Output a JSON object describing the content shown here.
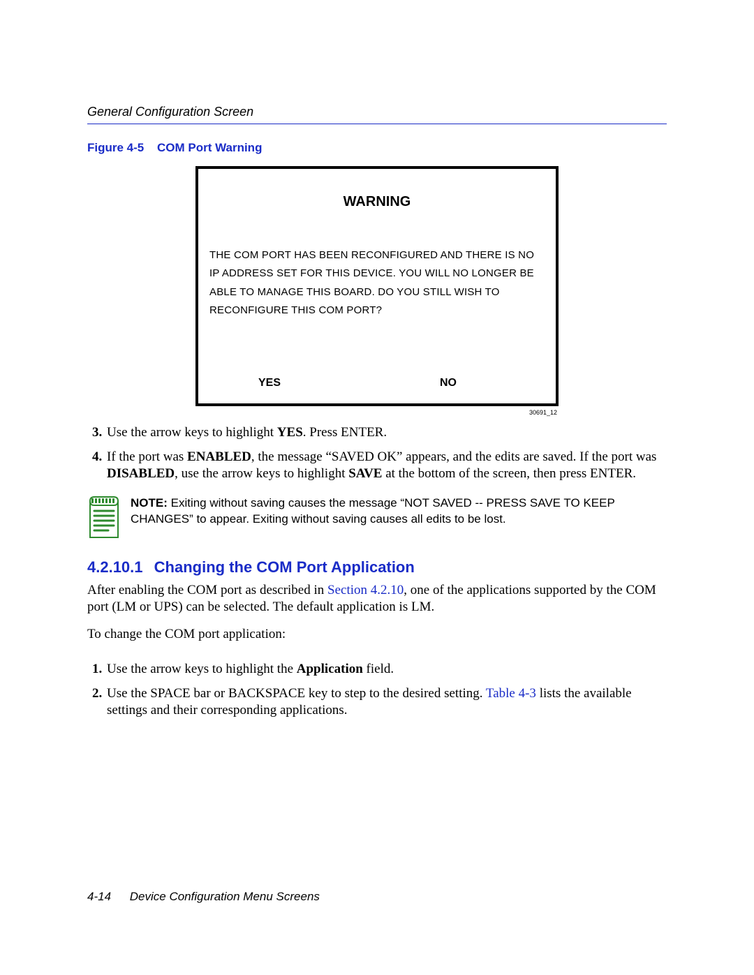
{
  "header": {
    "running_head": "General Configuration Screen"
  },
  "figure": {
    "label": "Figure 4-5",
    "title": "COM Port Warning",
    "screen_title": "WARNING",
    "screen_body": "THE COM PORT HAS BEEN RECONFIGURED AND THERE IS NO IP ADDRESS SET FOR THIS DEVICE. YOU WILL NO LONGER BE ABLE TO MANAGE THIS BOARD. DO YOU STILL WISH TO RECONFIGURE THIS COM PORT?",
    "yes": "YES",
    "no": "NO",
    "id": "30691_12"
  },
  "steps_a": {
    "s3_pre": "Use the arrow keys to highlight ",
    "s3_bold": "YES",
    "s3_post": ". Press ENTER.",
    "s4_a": "If the port was ",
    "s4_b": "ENABLED",
    "s4_c": ", the message “SAVED OK” appears, and the edits are saved. If the port was ",
    "s4_d": "DISABLED",
    "s4_e": ", use the arrow keys to highlight ",
    "s4_f": "SAVE",
    "s4_g": " at the bottom of the screen, then press ENTER."
  },
  "note": {
    "lead": "NOTE:",
    "text": "  Exiting without saving causes the message “NOT SAVED -- PRESS SAVE TO KEEP CHANGES” to appear. Exiting without saving causes all edits to be lost."
  },
  "section": {
    "num": "4.2.10.1",
    "title": "Changing the COM Port Application"
  },
  "para1_a": "After enabling the COM port as described in ",
  "para1_link": "Section 4.2.10",
  "para1_b": ", one of the applications supported by the COM port (LM or UPS) can be selected. The default application is LM.",
  "para2": "To change the COM port application:",
  "steps_b": {
    "s1_a": "Use the arrow keys to highlight the ",
    "s1_b": "Application",
    "s1_c": " field.",
    "s2_a": "Use the SPACE bar or BACKSPACE key to step to the desired setting. ",
    "s2_link": "Table 4-3",
    "s2_b": " lists the available settings and their corresponding applications."
  },
  "footer": {
    "page": "4-14",
    "chapter": "Device Configuration Menu Screens"
  }
}
